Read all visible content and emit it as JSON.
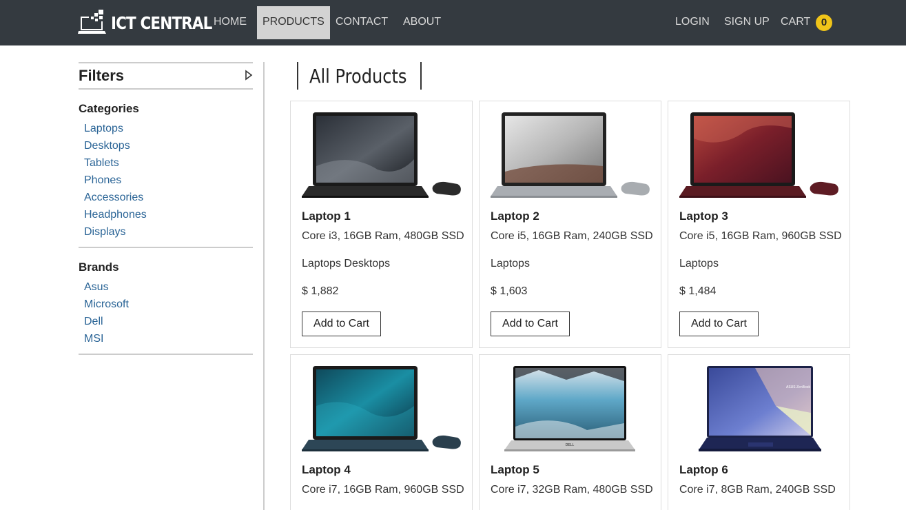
{
  "brand": {
    "name": "ICT CENTRAL",
    "logo_icon": "laptop-pixels-icon"
  },
  "nav": {
    "home": "HOME",
    "products": "PRODUCTS",
    "contact": "CONTACT",
    "about": "ABOUT",
    "login": "LOGIN",
    "signup": "SIGN UP",
    "cart": "CART",
    "cart_count": "0"
  },
  "colors": {
    "navbar": "#343a40",
    "active_tab": "#d3d3d3",
    "badge": "#f0c419",
    "link": "#2a6496"
  },
  "sidebar": {
    "title": "Filters",
    "toggle_icon": "caret-right-icon",
    "categories_title": "Categories",
    "categories": [
      "Laptops",
      "Desktops",
      "Tablets",
      "Phones",
      "Accessories",
      "Headphones",
      "Displays"
    ],
    "brands_title": "Brands",
    "brands": [
      "Asus",
      "Microsoft",
      "Dell",
      "MSI"
    ]
  },
  "main": {
    "title": "All Products",
    "add_to_cart_label": "Add to Cart",
    "products": [
      {
        "name": "Laptop 1",
        "specs": "Core i3, 16GB Ram, 480GB SSD",
        "categories": "Laptops Desktops",
        "price": "$ 1,882",
        "image": "surface-laptop-black-image"
      },
      {
        "name": "Laptop 2",
        "specs": "Core i5, 16GB Ram, 240GB SSD",
        "categories": "Laptops",
        "price": "$ 1,603",
        "image": "surface-laptop-platinum-image"
      },
      {
        "name": "Laptop 3",
        "specs": "Core i5, 16GB Ram, 960GB SSD",
        "categories": "Laptops",
        "price": "$ 1,484",
        "image": "surface-laptop-burgundy-image"
      },
      {
        "name": "Laptop 4",
        "specs": "Core i7, 16GB Ram, 960GB SSD",
        "image": "surface-laptop-cobalt-image"
      },
      {
        "name": "Laptop 5",
        "specs": "Core i7, 32GB Ram, 480GB SSD",
        "image": "dell-xps-laptop-image"
      },
      {
        "name": "Laptop 6",
        "specs": "Core i7, 8GB Ram, 240GB SSD",
        "image": "asus-zenbook-laptop-image"
      }
    ]
  }
}
